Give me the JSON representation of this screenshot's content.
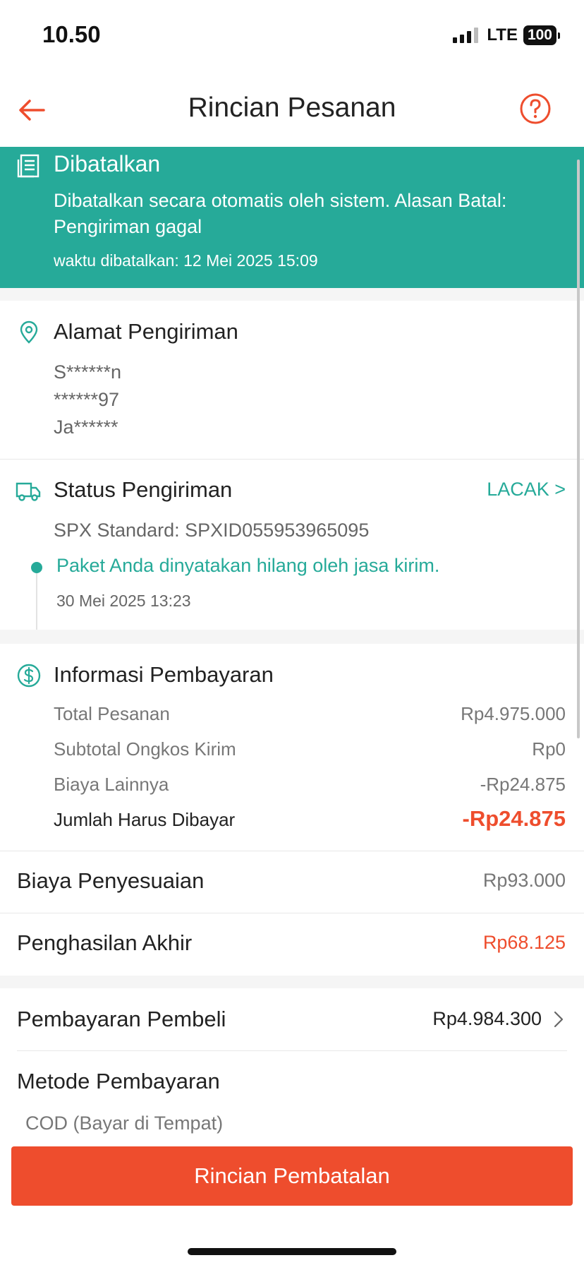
{
  "status_bar": {
    "time": "10.50",
    "network": "LTE",
    "battery": "100"
  },
  "nav": {
    "title": "Rincian Pesanan",
    "back_icon": "arrow-left-icon",
    "help_icon": "question-circle-icon"
  },
  "banner": {
    "title": "Dibatalkan",
    "description": "Dibatalkan secara otomatis oleh sistem. Alasan Batal: Pengiriman gagal",
    "cancel_time": "waktu dibatalkan: 12 Mei 2025 15:09",
    "background": "#26aa99"
  },
  "address": {
    "title": "Alamat Pengiriman",
    "lines": [
      "S******n",
      "******97",
      "Ja******"
    ]
  },
  "shipping": {
    "title": "Status Pengiriman",
    "track_label": "LACAK >",
    "service": "SPX Standard: SPXID055953965095",
    "latest_status": "Paket Anda dinyatakan hilang oleh jasa kirim.",
    "latest_time": "30 Mei 2025 13:23"
  },
  "payment_info": {
    "title": "Informasi Pembayaran",
    "rows": [
      {
        "label": "Total Pesanan",
        "value": "Rp4.975.000"
      },
      {
        "label": "Subtotal Ongkos Kirim",
        "value": "Rp0"
      },
      {
        "label": "Biaya Lainnya",
        "value": "-Rp24.875"
      }
    ],
    "total": {
      "label": "Jumlah Harus Dibayar",
      "value": "-Rp24.875"
    }
  },
  "adjustment": {
    "label": "Biaya Penyesuaian",
    "value": "Rp93.000"
  },
  "final_income": {
    "label": "Penghasilan Akhir",
    "value": "Rp68.125"
  },
  "buyer_payment": {
    "label": "Pembayaran Pembeli",
    "value": "Rp4.984.300"
  },
  "payment_method": {
    "label": "Metode Pembayaran",
    "value": "COD (Bayar di Tempat)"
  },
  "cancel_details_button": "Rincian Pembatalan",
  "colors": {
    "accent": "#ee4d2d",
    "teal": "#26aa99"
  }
}
